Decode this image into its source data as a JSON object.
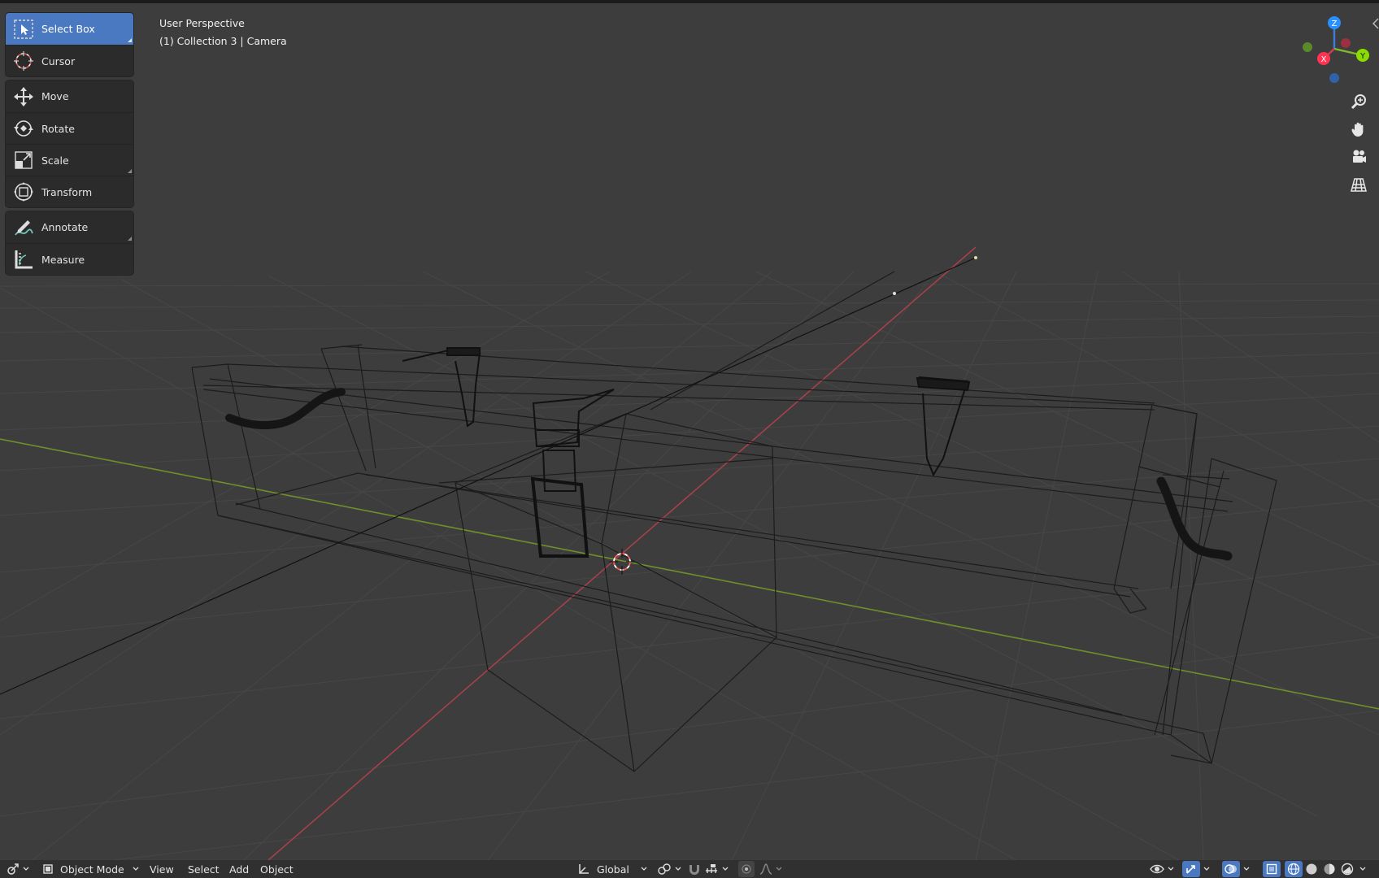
{
  "viewport": {
    "title": "User Perspective",
    "subtitle": "(1) Collection 3 | Camera"
  },
  "toolbar": {
    "select_box": "Select Box",
    "cursor": "Cursor",
    "move": "Move",
    "rotate": "Rotate",
    "scale": "Scale",
    "transform": "Transform",
    "annotate": "Annotate",
    "measure": "Measure"
  },
  "gizmo": {
    "x": "X",
    "y": "Y",
    "z": "Z"
  },
  "header": {
    "mode": "Object Mode",
    "menus": {
      "view": "View",
      "select": "Select",
      "add": "Add",
      "object": "Object"
    },
    "orientation": "Global"
  },
  "colors": {
    "background": "#3d3d3d",
    "active_tool": "#4a79c2",
    "axis_x": "#ff3352",
    "axis_y": "#8bdc00",
    "axis_z": "#2890ff"
  }
}
